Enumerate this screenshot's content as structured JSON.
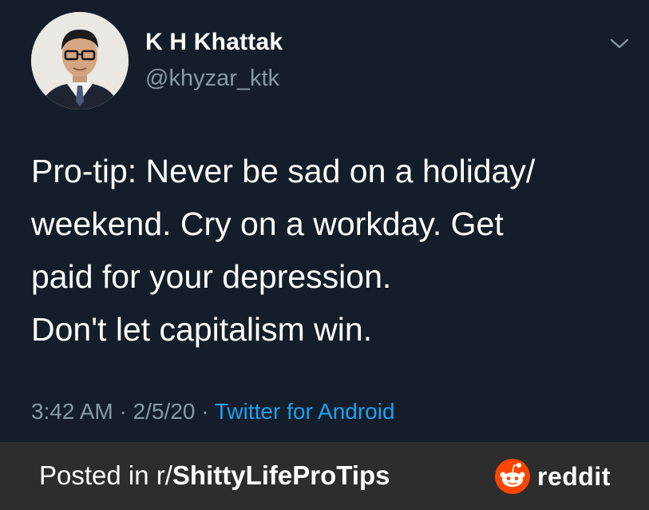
{
  "tweet": {
    "author_name": "K H Khattak",
    "author_handle": "@khyzar_ktk",
    "body_lines": [
      "Pro-tip: Never be sad on a holiday/",
      "weekend. Cry on a workday. Get",
      "paid for your depression.",
      "Don't let capitalism win."
    ],
    "time": "3:42 AM",
    "separator": " · ",
    "date": "2/5/20",
    "source": "Twitter for Android",
    "menu_icon": "chevron-down-icon"
  },
  "footer": {
    "posted_prefix": "Posted in r/",
    "subreddit": "ShittyLifeProTips",
    "brand": "reddit",
    "brand_icon": "reddit-snoo-icon"
  },
  "colors": {
    "background": "#141d2a",
    "text": "#ffffff",
    "muted": "#8899a6",
    "link": "#1da1f2",
    "footer_bg": "#2d2d2d",
    "reddit_orange": "#ff4500"
  }
}
